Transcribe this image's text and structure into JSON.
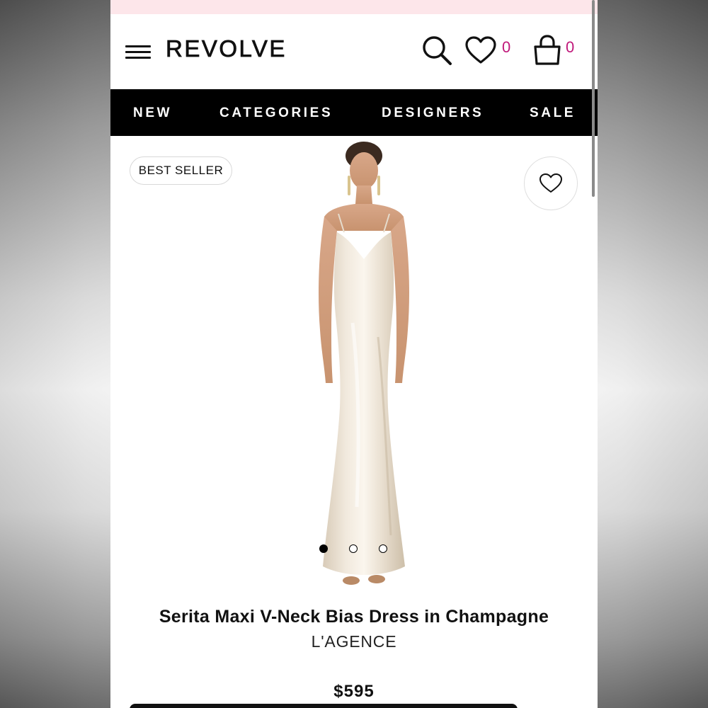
{
  "header": {
    "logo": "REVOLVE",
    "wishlist_count": "0",
    "bag_count": "0",
    "count_color": "#c0187a"
  },
  "nav": {
    "items": [
      "NEW",
      "CATEGORIES",
      "DESIGNERS",
      "SALE"
    ]
  },
  "product": {
    "badge": "BEST SELLER",
    "title": "Serita Maxi V-Neck Bias Dress in Champagne",
    "brand": "L'AGENCE",
    "price": "$595",
    "image_slides": 3,
    "active_slide": 1
  },
  "icons": {
    "menu": "hamburger-menu-icon",
    "search": "search-icon",
    "wishlist": "heart-icon",
    "bag": "shopping-bag-icon",
    "favorite": "heart-outline-icon"
  },
  "colors": {
    "nav_background": "#000000",
    "promo_strip": "#fde6ea",
    "accent": "#c0187a"
  }
}
